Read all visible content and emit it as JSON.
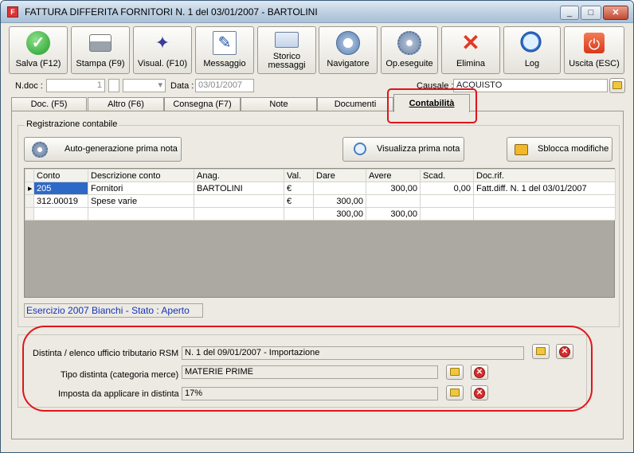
{
  "window": {
    "title": "FATTURA DIFFERITA FORNITORI N. 1  del 03/01/2007 - BARTOLINI",
    "min": "_",
    "max": "□",
    "close": "✕"
  },
  "toolbar": [
    {
      "label": "Salva (F12)",
      "icon": "check-icon"
    },
    {
      "label": "Stampa (F9)",
      "icon": "printer-icon"
    },
    {
      "label": "Visual. (F10)",
      "icon": "magic-wand-icon"
    },
    {
      "label": "Messaggio",
      "icon": "pen-icon"
    },
    {
      "label": "Storico\nmessaggi",
      "icon": "envelope-icon"
    },
    {
      "label": "Navigatore",
      "icon": "compass-icon"
    },
    {
      "label": "Op.eseguite",
      "icon": "gears-icon"
    },
    {
      "label": "Elimina",
      "icon": "red-x-icon"
    },
    {
      "label": "Log",
      "icon": "magnifier-icon"
    },
    {
      "label": "Uscita (ESC)",
      "icon": "power-icon"
    }
  ],
  "header": {
    "ndoc_label": "N.doc :",
    "ndoc_value": "1",
    "data_label": "Data :",
    "data_value": "03/01/2007",
    "causale_label": "Causale :",
    "causale_value": "ACQUISTO"
  },
  "tabs": [
    "Doc. (F5)",
    "Altro (F6)",
    "Consegna (F7)",
    "Note",
    "Documenti",
    "Contabilità"
  ],
  "contabilita": {
    "group_title": "Registrazione contabile",
    "auto_button": "Auto-generazione prima nota",
    "view_button": "Visualizza prima nota",
    "unlock_button": "Sblocca modifiche",
    "columns": [
      "Conto",
      "Descrizione conto",
      "Anag.",
      "Val.",
      "Dare",
      "Avere",
      "Scad.",
      "Doc.rif."
    ],
    "rows": [
      [
        "205",
        "Fornitori",
        "BARTOLINI",
        "€",
        "",
        "300,00",
        "0,00",
        "Fatt.diff. N. 1 del 03/01/2007"
      ],
      [
        "312.00019",
        "Spese varie",
        "",
        "€",
        "300,00",
        "",
        "",
        ""
      ],
      [
        "",
        "",
        "",
        "",
        "300,00",
        "300,00",
        "",
        ""
      ]
    ],
    "esercizio": "Esercizio 2007 Bianchi - Stato : Aperto"
  },
  "distinta": {
    "rsm_label": "Distinta / elenco ufficio tributario RSM :",
    "rsm_value": "N. 1 del 09/01/2007 - Importazione",
    "tipo_label": "Tipo distinta (categoria merce) :",
    "tipo_value": "MATERIE PRIME",
    "imposta_label": "Imposta da applicare in distinta :",
    "imposta_value": "17%"
  }
}
